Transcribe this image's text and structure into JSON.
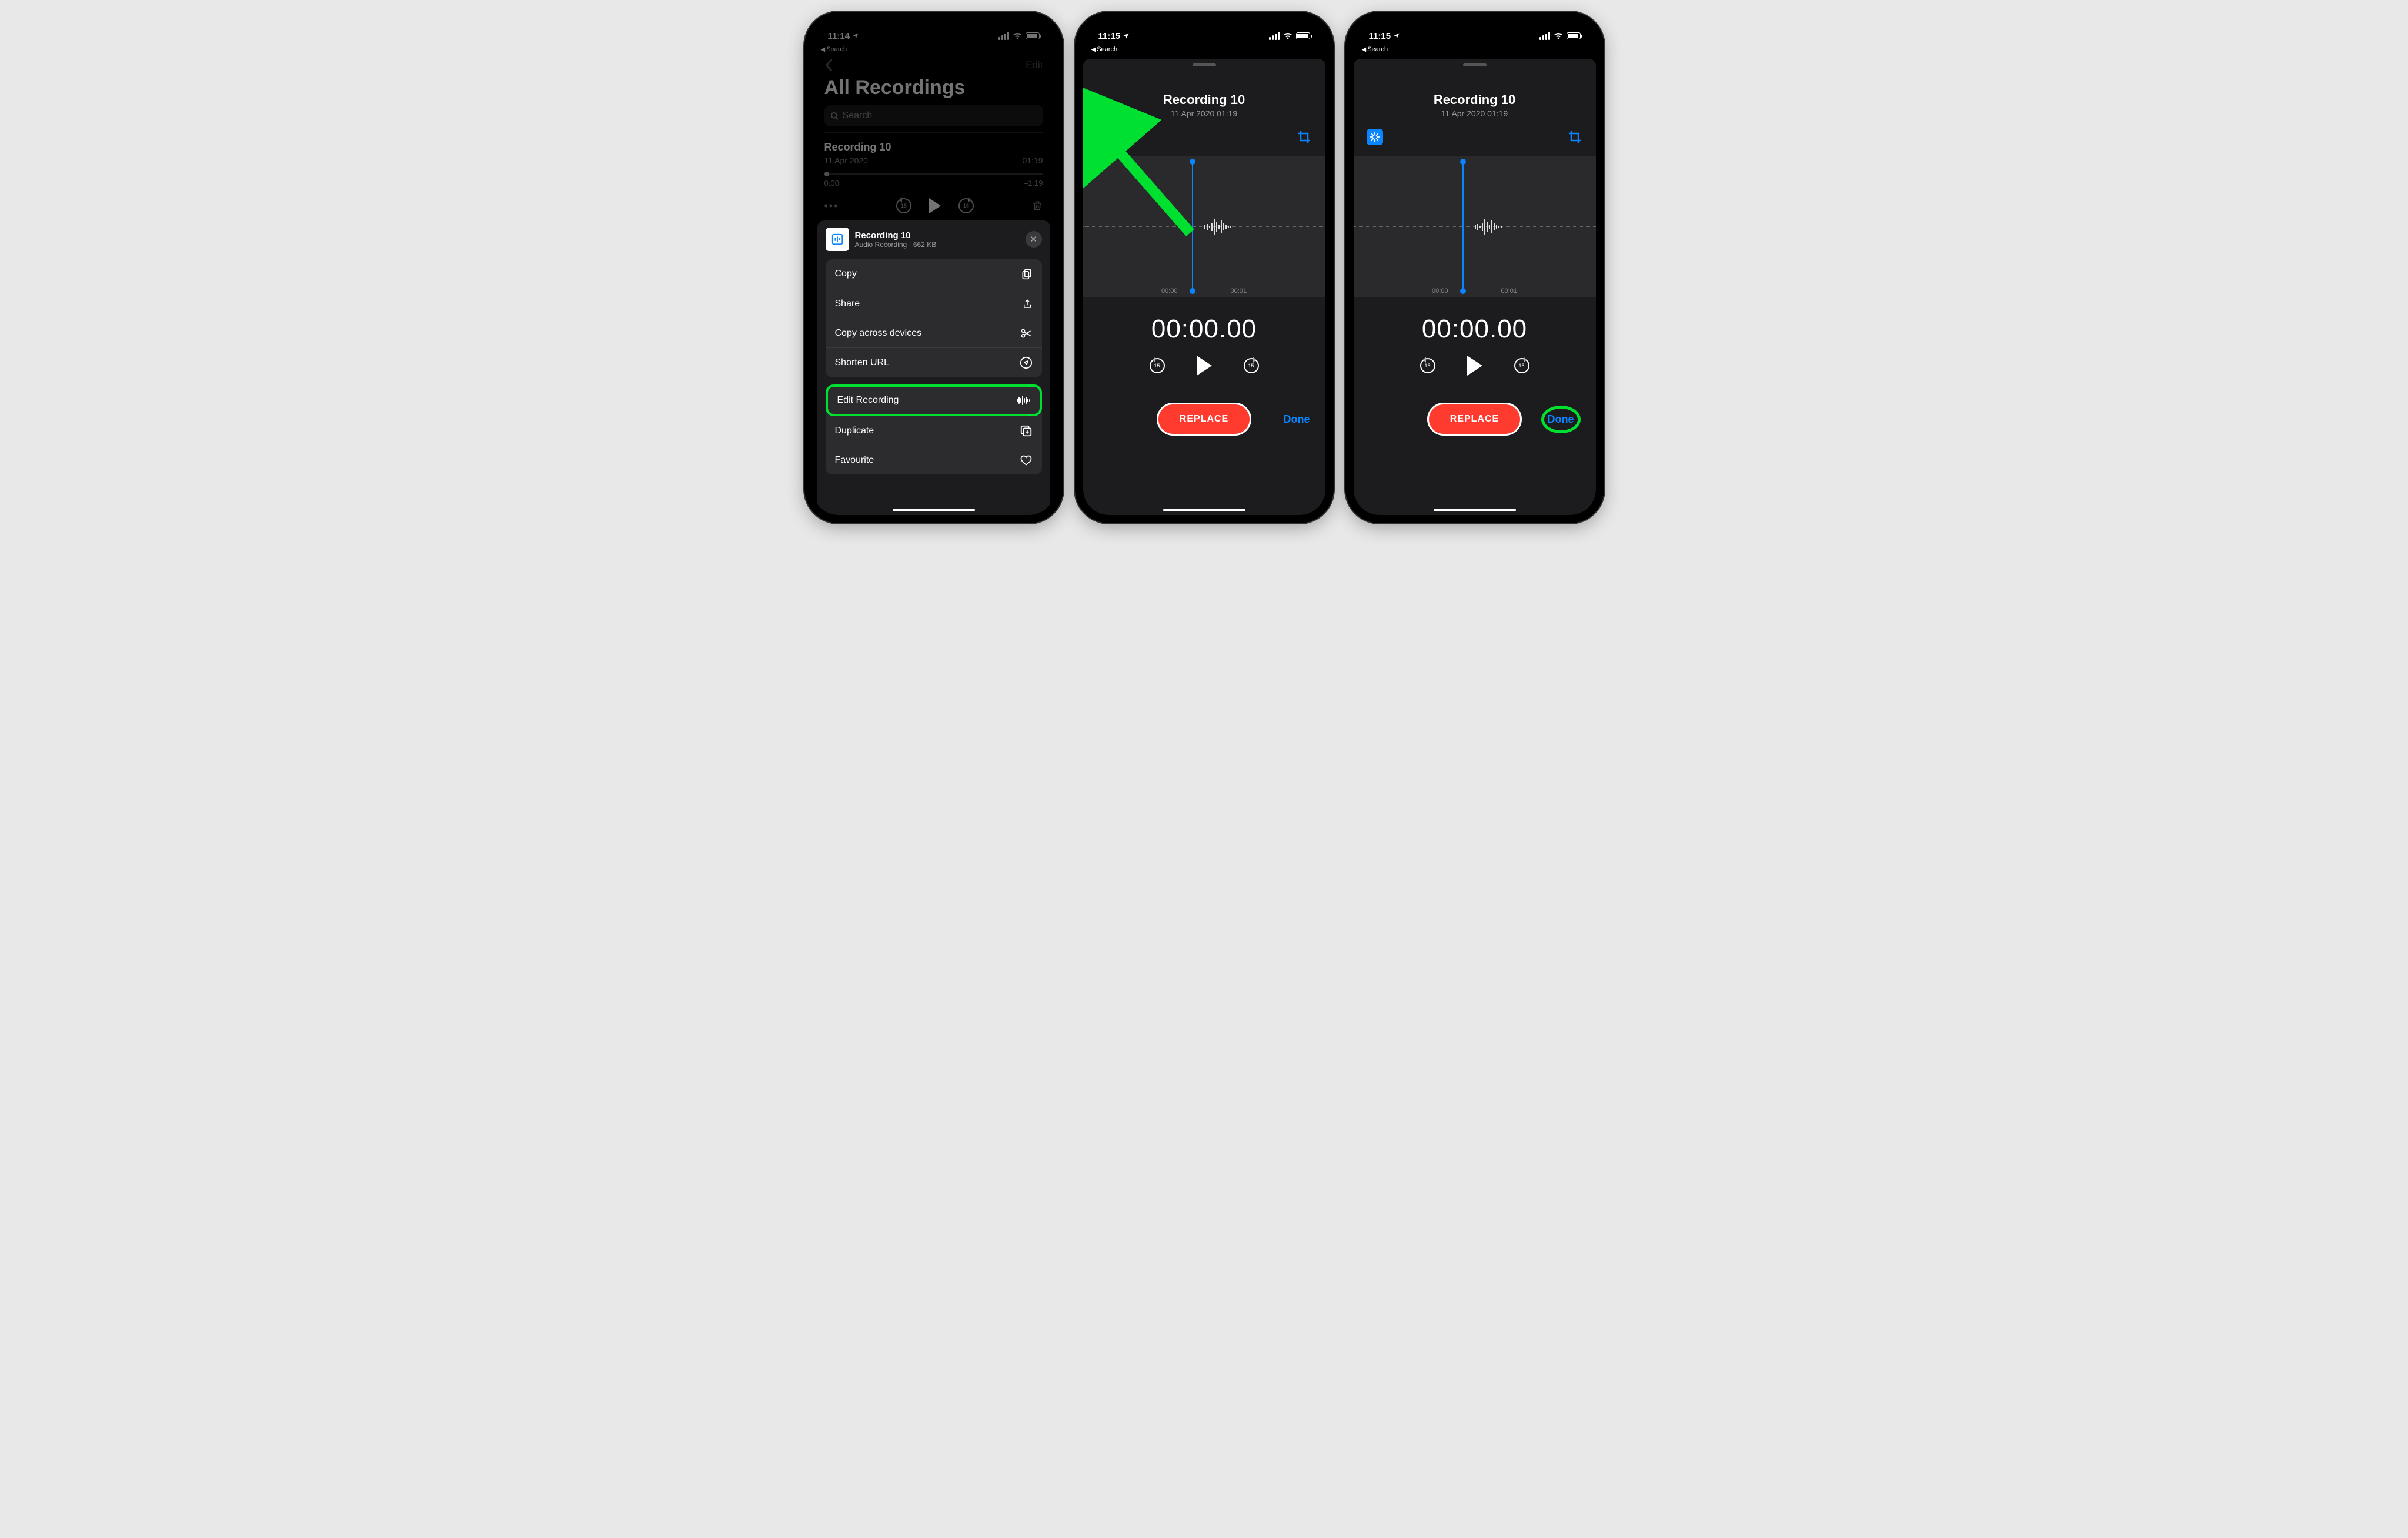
{
  "status": {
    "time1": "11:14",
    "time2": "11:15",
    "time3": "11:15",
    "back_label": "Search"
  },
  "phone1": {
    "nav_edit": "Edit",
    "title": "All Recordings",
    "search_placeholder": "Search",
    "recording_title": "Recording 10",
    "recording_date": "11 Apr 2020",
    "recording_len": "01:19",
    "scrub_start": "0:00",
    "scrub_end": "–1:19",
    "sheet_title": "Recording 10",
    "sheet_subtitle": "Audio Recording · 662 KB",
    "actions": {
      "copy": "Copy",
      "share": "Share",
      "copy_across": "Copy across devices",
      "shorten": "Shorten URL",
      "edit_recording": "Edit Recording",
      "duplicate": "Duplicate",
      "favourite": "Favourite"
    }
  },
  "editor": {
    "title": "Recording 10",
    "subtitle": "11 Apr 2020  01:19",
    "time_marks": {
      "a": "00:00",
      "b": "00:01"
    },
    "big_time": "00:00.00",
    "skip_val": "15",
    "replace": "REPLACE",
    "done": "Done"
  }
}
